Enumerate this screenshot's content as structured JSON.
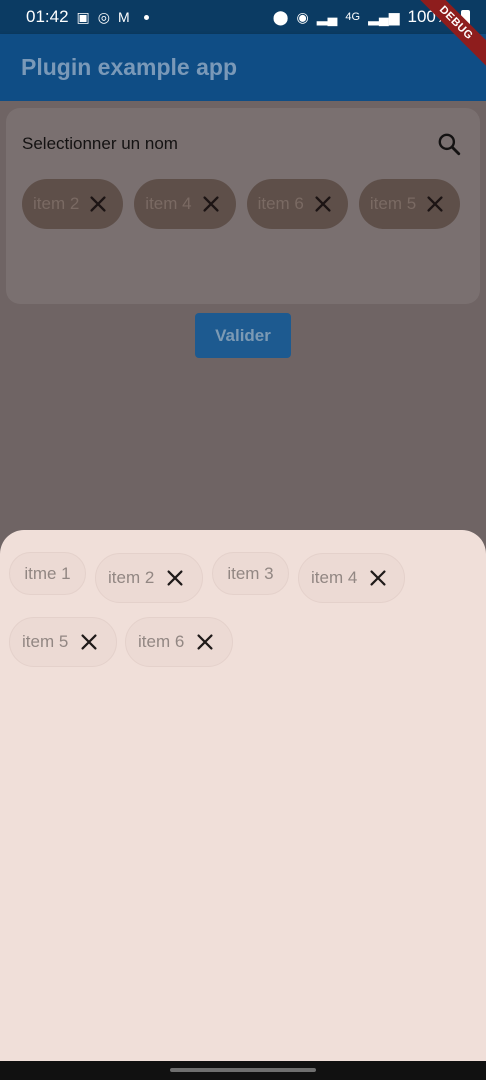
{
  "status_bar": {
    "time": "01:42",
    "network": "4G",
    "battery": "100%"
  },
  "debug_banner": "DEBUG",
  "app_bar": {
    "title": "Plugin example app"
  },
  "card": {
    "label": "Selectionner un nom",
    "selected_chips": [
      "item 2",
      "item 4",
      "item 6",
      "item 5"
    ]
  },
  "valider_label": "Valider",
  "sheet": {
    "chips": [
      {
        "label": "itme 1",
        "removable": false
      },
      {
        "label": "item 2",
        "removable": true
      },
      {
        "label": "item 3",
        "removable": false
      },
      {
        "label": "item 4",
        "removable": true
      },
      {
        "label": "item 5",
        "removable": true
      },
      {
        "label": "item 6",
        "removable": true
      }
    ]
  },
  "colors": {
    "app_bar": "#0f4d85",
    "status_bar": "#0b3b63",
    "scrim_page": "#6f6464",
    "sheet": "#f0dfd9",
    "button": "#1d5a90"
  }
}
